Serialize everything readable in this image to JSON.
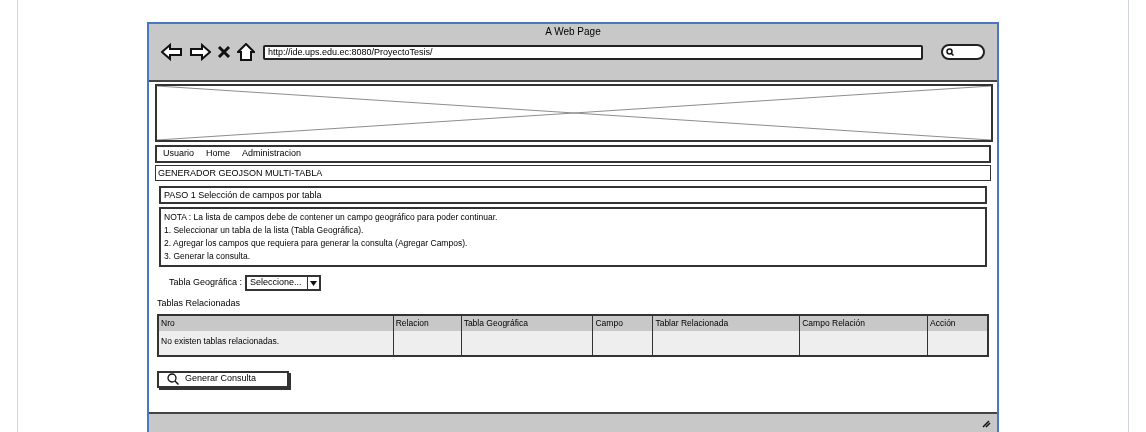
{
  "window": {
    "title": "A Web Page",
    "url": "http://ide.ups.edu.ec:8080/ProyectoTesis/"
  },
  "menu": [
    "Usuario",
    "Home",
    "Administracion"
  ],
  "page_title": "GENERADOR GEOJSON MULTI-TABLA",
  "step": "PASO 1 Selección de campos por tabla",
  "note": [
    "NOTA : La lista de campos debe de contener un campo geográfico para poder continuar.",
    "1. Seleccionar un tabla de la lista (Tabla Geográfica).",
    "2. Agregar los campos que requiera para generar la consulta (Agregar Campos).",
    "3. Generar la consulta."
  ],
  "geo_table": {
    "label": "Tabla Geográfica :",
    "value": "Seleccione..."
  },
  "related_title": "Tablas Relacionadas",
  "table": {
    "columns": [
      "Nro",
      "Relacion",
      "Tabla Geográfica",
      "Campo",
      "Tablar Relacionada",
      "Campo Relación",
      "Acción"
    ],
    "empty_message": "No existen tablas relacionadas."
  },
  "button": "Generar Consulta"
}
